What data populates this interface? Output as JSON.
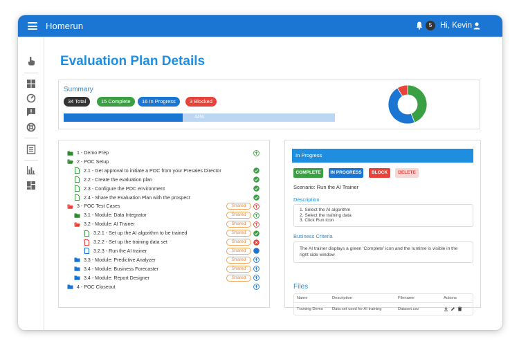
{
  "app": {
    "title": "Homerun",
    "notification_count": "5",
    "greeting": "Hi, Kevin"
  },
  "sidebar": {
    "icons": [
      "touch-icon",
      "dashboard-icon",
      "speed-icon",
      "feedback-icon",
      "lifebuoy-icon",
      "document-icon",
      "bar-chart-icon",
      "widgets-icon"
    ]
  },
  "page": {
    "title": "Evaluation Plan Details"
  },
  "summary": {
    "label": "Summary",
    "pills": [
      {
        "label": "34 Total",
        "color": "#333333"
      },
      {
        "label": "15 Complete",
        "color": "#3ba044"
      },
      {
        "label": "16 In Progress",
        "color": "#1a76d2"
      },
      {
        "label": "3 Blocked",
        "color": "#e8433a"
      }
    ],
    "progress_value": 0.44,
    "progress_label": "44%"
  },
  "chart_data": {
    "type": "pie",
    "categories": [
      "Complete",
      "In Progress",
      "Blocked"
    ],
    "values": [
      15,
      16,
      3
    ],
    "colors": [
      "#3ba044",
      "#1a76d2",
      "#e8433a"
    ]
  },
  "tree": {
    "rows": [
      {
        "label": "1 - Demo Prep",
        "icon": "folder-icon",
        "color": "#2e8b2e",
        "status": "up-arrow-icon",
        "status_color": "#3ba044",
        "shared": ""
      },
      {
        "label": "2 - POC Setup",
        "icon": "folder-open-icon",
        "color": "#2e8b2e",
        "status": "",
        "status_color": "",
        "shared": ""
      },
      {
        "label": "2.1 - Get approval to initiate a POC from your Presales Director",
        "icon": "file-icon",
        "color": "#3ba044",
        "status": "check-icon",
        "status_color": "#3ba044",
        "shared": ""
      },
      {
        "label": "2.2 - Create the evaluation plan",
        "icon": "file-icon",
        "color": "#3ba044",
        "status": "check-icon",
        "status_color": "#3ba044",
        "shared": ""
      },
      {
        "label": "2.3 - Configure the POC environment",
        "icon": "file-icon",
        "color": "#3ba044",
        "status": "check-icon",
        "status_color": "#3ba044",
        "shared": ""
      },
      {
        "label": "2.4 - Share the Evaluation Plan with the prospect",
        "icon": "file-icon",
        "color": "#3ba044",
        "status": "check-icon",
        "status_color": "#3ba044",
        "shared": ""
      },
      {
        "label": "3 - POC Test Cases",
        "icon": "folder-open-icon",
        "color": "#e8433a",
        "status": "up-arrow-icon",
        "status_color": "#e8433a",
        "shared": "Shared"
      },
      {
        "label": "3.1 - Module: Data Integrator",
        "icon": "folder-icon",
        "color": "#2e8b2e",
        "status": "up-arrow-icon",
        "status_color": "#3ba044",
        "shared": "Shared"
      },
      {
        "label": "3.2 - Module: AI Trainer",
        "icon": "folder-open-icon",
        "color": "#e8433a",
        "status": "up-arrow-icon",
        "status_color": "#e8433a",
        "shared": "Shared"
      },
      {
        "label": "3.2.1 - Set up the AI algorithm to be trained",
        "icon": "file-icon",
        "color": "#3ba044",
        "status": "check-icon",
        "status_color": "#3ba044",
        "shared": "Shared"
      },
      {
        "label": "3.2.2 - Set up the training data set",
        "icon": "file-icon",
        "color": "#e8433a",
        "status": "cross-icon",
        "status_color": "#e8433a",
        "shared": "Shared"
      },
      {
        "label": "3.2.3 - Run the AI trainer",
        "icon": "file-icon",
        "color": "#1a76d2",
        "status": "dot-icon",
        "status_color": "#1a76d2",
        "shared": "Shared"
      },
      {
        "label": "3.3 - Module: Predictive Analyzer",
        "icon": "folder-icon",
        "color": "#1a76d2",
        "status": "up-arrow-icon",
        "status_color": "#1a76d2",
        "shared": "Shared"
      },
      {
        "label": "3.4 - Module: Business Forecaster",
        "icon": "folder-icon",
        "color": "#1a76d2",
        "status": "up-arrow-icon",
        "status_color": "#1a76d2",
        "shared": "Shared"
      },
      {
        "label": "3.4 - Module: Report Designer",
        "icon": "folder-icon",
        "color": "#1a76d2",
        "status": "up-arrow-icon",
        "status_color": "#1a76d2",
        "shared": "Shared"
      },
      {
        "label": "4 - POC Closeout",
        "icon": "folder-icon",
        "color": "#1a76d2",
        "status": "up-arrow-icon",
        "status_color": "#1a76d2",
        "shared": ""
      }
    ]
  },
  "detail": {
    "header": "In Progress",
    "buttons": [
      {
        "label": "COMPLETE",
        "color": "#3ba044"
      },
      {
        "label": "IN PROGRESS",
        "color": "#1a76d2"
      },
      {
        "label": "BLOCK",
        "color": "#e8433a"
      },
      {
        "label": "DELETE",
        "color": "#f6d7d5"
      }
    ],
    "scenario": "Scenario: Run the AI Trainer",
    "description_label": "Description",
    "description_lines": [
      "1. Select the AI algorithm",
      "2. Select the training data",
      "3. Click Run icon"
    ],
    "criteria_label": "Business Criteria",
    "criteria_text": "The AI trainer displays a green 'Complete' icon and the runtime is visible in the right side window",
    "files_title": "Files",
    "files_headers": [
      "Name",
      "Description",
      "Filename",
      "Actions"
    ],
    "files_rows": [
      {
        "name": "Training Demo",
        "description": "Data set used for AI training",
        "filename": "Dataset.csv"
      }
    ]
  }
}
